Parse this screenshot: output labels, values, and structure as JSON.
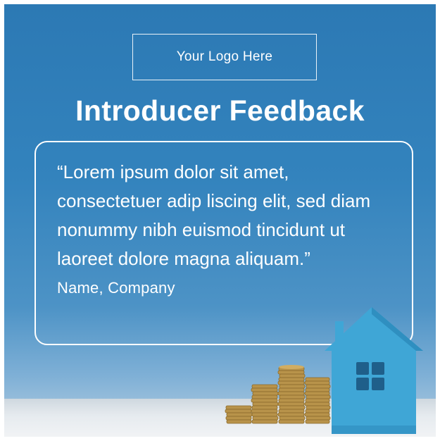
{
  "logo": {
    "label": "Your Logo Here"
  },
  "title": "Introducer Feedback",
  "testimonial": {
    "quote": "“Lorem ipsum dolor sit amet, consectetuer adip liscing elit, sed diam nonummy nibh euismod tincidunt ut laoreet dolore magna aliquam.”",
    "author": "Name, Company"
  },
  "colors": {
    "background_top": "#2c79b4",
    "background_bottom": "#b9d0e2",
    "house": "#3fa6d6",
    "coins": "#b8934a",
    "text": "#ffffff"
  },
  "icons": [
    "house-icon",
    "coin-stack-icon"
  ]
}
